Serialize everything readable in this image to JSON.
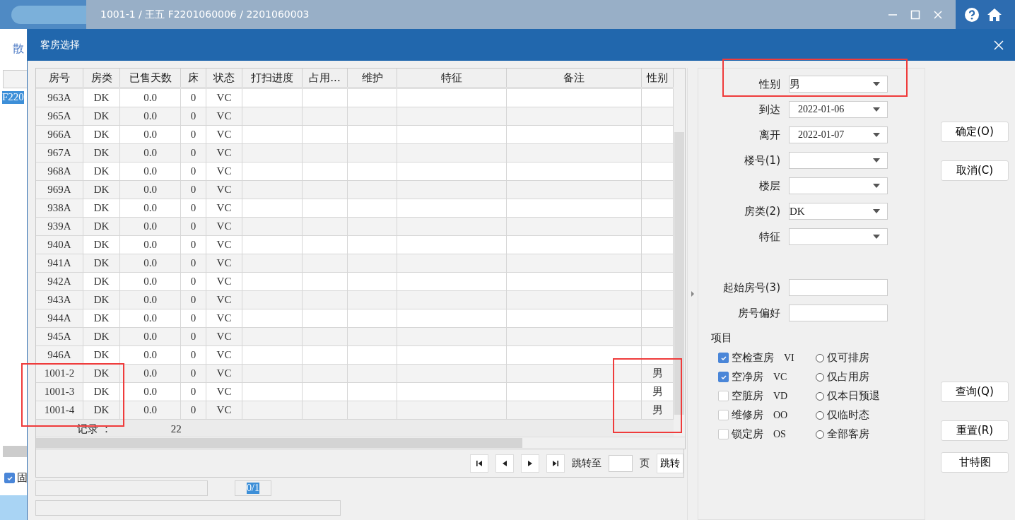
{
  "app": {
    "title": "1001-1 / 王五 F2201060006 / 2201060003",
    "tab_label": "散",
    "selected_cell": "F220",
    "checkbox": {
      "label": "固",
      "checked": true
    }
  },
  "dialog": {
    "title": "客房选择"
  },
  "table": {
    "columns": [
      "房号",
      "房类",
      "已售天数",
      "床",
      "状态",
      "打扫进度",
      "占用...",
      "维护",
      "特征",
      "备注",
      "性别"
    ],
    "rows": [
      {
        "room": "963A",
        "type": "DK",
        "sold_days": "0.0",
        "bed": "0",
        "status": "VC"
      },
      {
        "room": "965A",
        "type": "DK",
        "sold_days": "0.0",
        "bed": "0",
        "status": "VC"
      },
      {
        "room": "966A",
        "type": "DK",
        "sold_days": "0.0",
        "bed": "0",
        "status": "VC"
      },
      {
        "room": "967A",
        "type": "DK",
        "sold_days": "0.0",
        "bed": "0",
        "status": "VC"
      },
      {
        "room": "968A",
        "type": "DK",
        "sold_days": "0.0",
        "bed": "0",
        "status": "VC"
      },
      {
        "room": "969A",
        "type": "DK",
        "sold_days": "0.0",
        "bed": "0",
        "status": "VC"
      },
      {
        "room": "938A",
        "type": "DK",
        "sold_days": "0.0",
        "bed": "0",
        "status": "VC"
      },
      {
        "room": "939A",
        "type": "DK",
        "sold_days": "0.0",
        "bed": "0",
        "status": "VC"
      },
      {
        "room": "940A",
        "type": "DK",
        "sold_days": "0.0",
        "bed": "0",
        "status": "VC"
      },
      {
        "room": "941A",
        "type": "DK",
        "sold_days": "0.0",
        "bed": "0",
        "status": "VC"
      },
      {
        "room": "942A",
        "type": "DK",
        "sold_days": "0.0",
        "bed": "0",
        "status": "VC"
      },
      {
        "room": "943A",
        "type": "DK",
        "sold_days": "0.0",
        "bed": "0",
        "status": "VC"
      },
      {
        "room": "944A",
        "type": "DK",
        "sold_days": "0.0",
        "bed": "0",
        "status": "VC"
      },
      {
        "room": "945A",
        "type": "DK",
        "sold_days": "0.0",
        "bed": "0",
        "status": "VC"
      },
      {
        "room": "946A",
        "type": "DK",
        "sold_days": "0.0",
        "bed": "0",
        "status": "VC"
      },
      {
        "room": "1001-2",
        "type": "DK",
        "sold_days": "0.0",
        "bed": "0",
        "status": "VC",
        "gender": "男"
      },
      {
        "room": "1001-3",
        "type": "DK",
        "sold_days": "0.0",
        "bed": "0",
        "status": "VC",
        "gender": "男"
      },
      {
        "room": "1001-4",
        "type": "DK",
        "sold_days": "0.0",
        "bed": "0",
        "status": "VC",
        "gender": "男"
      }
    ],
    "records_label": "记录 ：",
    "records_count": "22"
  },
  "pager": {
    "jump_to_label": "跳转至",
    "page_label": "页",
    "jump_button": "跳转",
    "page_indicator": "0/1"
  },
  "filters": [
    {
      "label": "性别",
      "kind": "select",
      "value": "男"
    },
    {
      "label": "到达",
      "kind": "date",
      "value": "2022-01-06"
    },
    {
      "label": "离开",
      "kind": "date",
      "value": "2022-01-07"
    },
    {
      "label": "楼号(1)",
      "kind": "select"
    },
    {
      "label": "楼层",
      "kind": "select"
    },
    {
      "label": "房类(2)",
      "kind": "select",
      "value": "DK"
    },
    {
      "label": "特征",
      "kind": "select"
    }
  ],
  "inputs": [
    {
      "label": "起始房号(3)"
    },
    {
      "label": "房号偏好"
    }
  ],
  "items_title": "项目",
  "checkboxes": [
    {
      "label": "空检查房",
      "code": "VI",
      "checked": true
    },
    {
      "label": "空净房",
      "code": "VC",
      "checked": true
    },
    {
      "label": "空脏房",
      "code": "VD",
      "checked": false
    },
    {
      "label": "维修房",
      "code": "OO",
      "checked": false
    },
    {
      "label": "锁定房",
      "code": "OS",
      "checked": false
    }
  ],
  "radios": [
    {
      "label": "仅可排房",
      "selected": false
    },
    {
      "label": "仅占用房",
      "selected": false
    },
    {
      "label": "仅本日预退",
      "selected": false
    },
    {
      "label": "仅临时态",
      "selected": false
    },
    {
      "label": "全部客房",
      "selected": false
    }
  ],
  "buttons_top": [
    "确定(O)",
    "取消(C)"
  ],
  "buttons_bottom": [
    "查询(Q)",
    "重置(R)",
    "甘特图"
  ]
}
